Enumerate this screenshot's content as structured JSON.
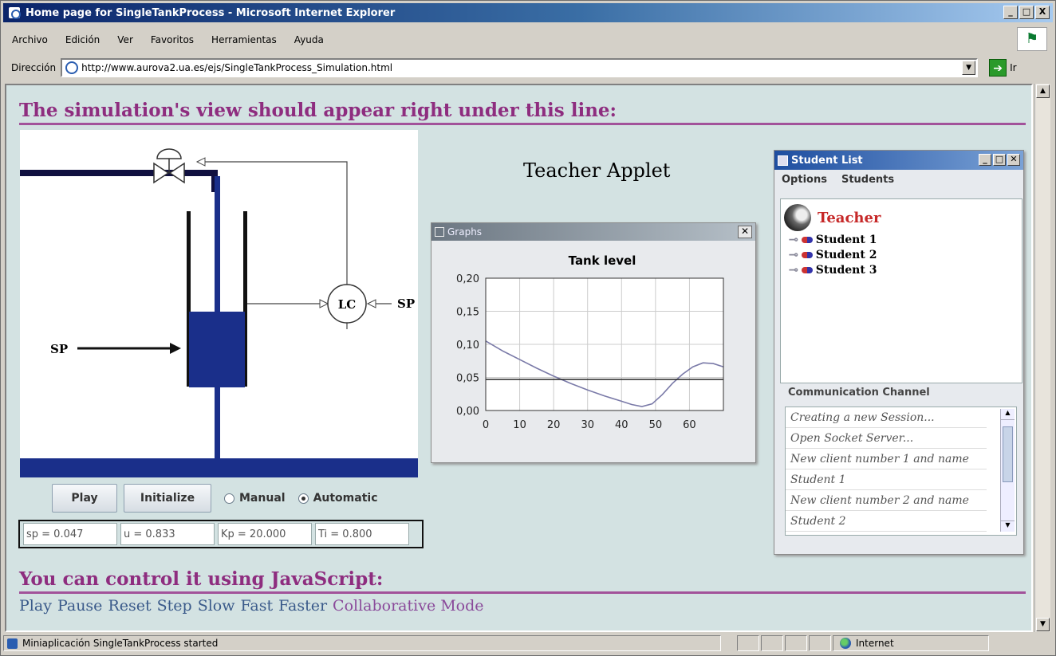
{
  "window": {
    "title": "Home page for SingleTankProcess - Microsoft Internet Explorer",
    "controls": [
      "_",
      "□",
      "X"
    ]
  },
  "menubar": [
    "Archivo",
    "Edición",
    "Ver",
    "Favoritos",
    "Herramientas",
    "Ayuda"
  ],
  "address": {
    "label": "Dirección",
    "url": "http://www.aurova2.ua.es/ejs/SingleTankProcess_Simulation.html",
    "go_label": "Ir"
  },
  "page": {
    "heading_top": "The simulation's view should appear right under this line:",
    "heading_bottom": "You can control it using JavaScript:",
    "links": [
      "Play",
      "Pause",
      "Reset",
      "Step",
      "Slow",
      "Fast",
      "Faster",
      "Collaborative Mode"
    ]
  },
  "simulation": {
    "sp_left": "SP",
    "sp_right": "SP",
    "controller_label": "LC",
    "buttons": {
      "play": "Play",
      "initialize": "Initialize"
    },
    "modes": {
      "manual": "Manual",
      "automatic": "Automatic",
      "selected": "automatic"
    },
    "fields": [
      "sp = 0.047",
      "u = 0.833",
      "Kp = 20.000",
      "Ti = 0.800"
    ],
    "tank_fill_fraction": 0.43
  },
  "teacher_applet": {
    "title": "Teacher Applet"
  },
  "graphs_window": {
    "title": "Graphs"
  },
  "student_list": {
    "title": "Student List",
    "menus": [
      "Options",
      "Students"
    ],
    "root": "Teacher",
    "students": [
      "Student 1",
      "Student 2",
      "Student 3"
    ],
    "comm_label": "Communication Channel",
    "messages": [
      "Creating a new Session...",
      "Open Socket Server...",
      "New client number 1 and name",
      "Student 1",
      "New client number 2 and name",
      "Student 2"
    ]
  },
  "statusbar": {
    "message": "Miniaplicación SingleTankProcess started",
    "zone": "Internet"
  },
  "chart_data": {
    "type": "line",
    "title": "Tank level",
    "xlabel": "",
    "ylabel": "",
    "xlim": [
      0,
      70
    ],
    "ylim": [
      0,
      0.2
    ],
    "xticks": [
      "0",
      "10",
      "20",
      "30",
      "40",
      "50",
      "60"
    ],
    "yticks": [
      "0,00",
      "0,05",
      "0,10",
      "0,15",
      "0,20"
    ],
    "grid": true,
    "series": [
      {
        "color": "#7a7aa8",
        "x": [
          0,
          5,
          10,
          15,
          20,
          25,
          30,
          35,
          40,
          43,
          46,
          49,
          52,
          55,
          58,
          61,
          64,
          67,
          70
        ],
        "y": [
          0.105,
          0.09,
          0.077,
          0.064,
          0.052,
          0.041,
          0.031,
          0.022,
          0.014,
          0.009,
          0.006,
          0.01,
          0.024,
          0.041,
          0.055,
          0.066,
          0.072,
          0.071,
          0.066
        ]
      },
      {
        "color": "#222222",
        "x": [
          0,
          70
        ],
        "y": [
          0.047,
          0.047
        ]
      }
    ]
  }
}
